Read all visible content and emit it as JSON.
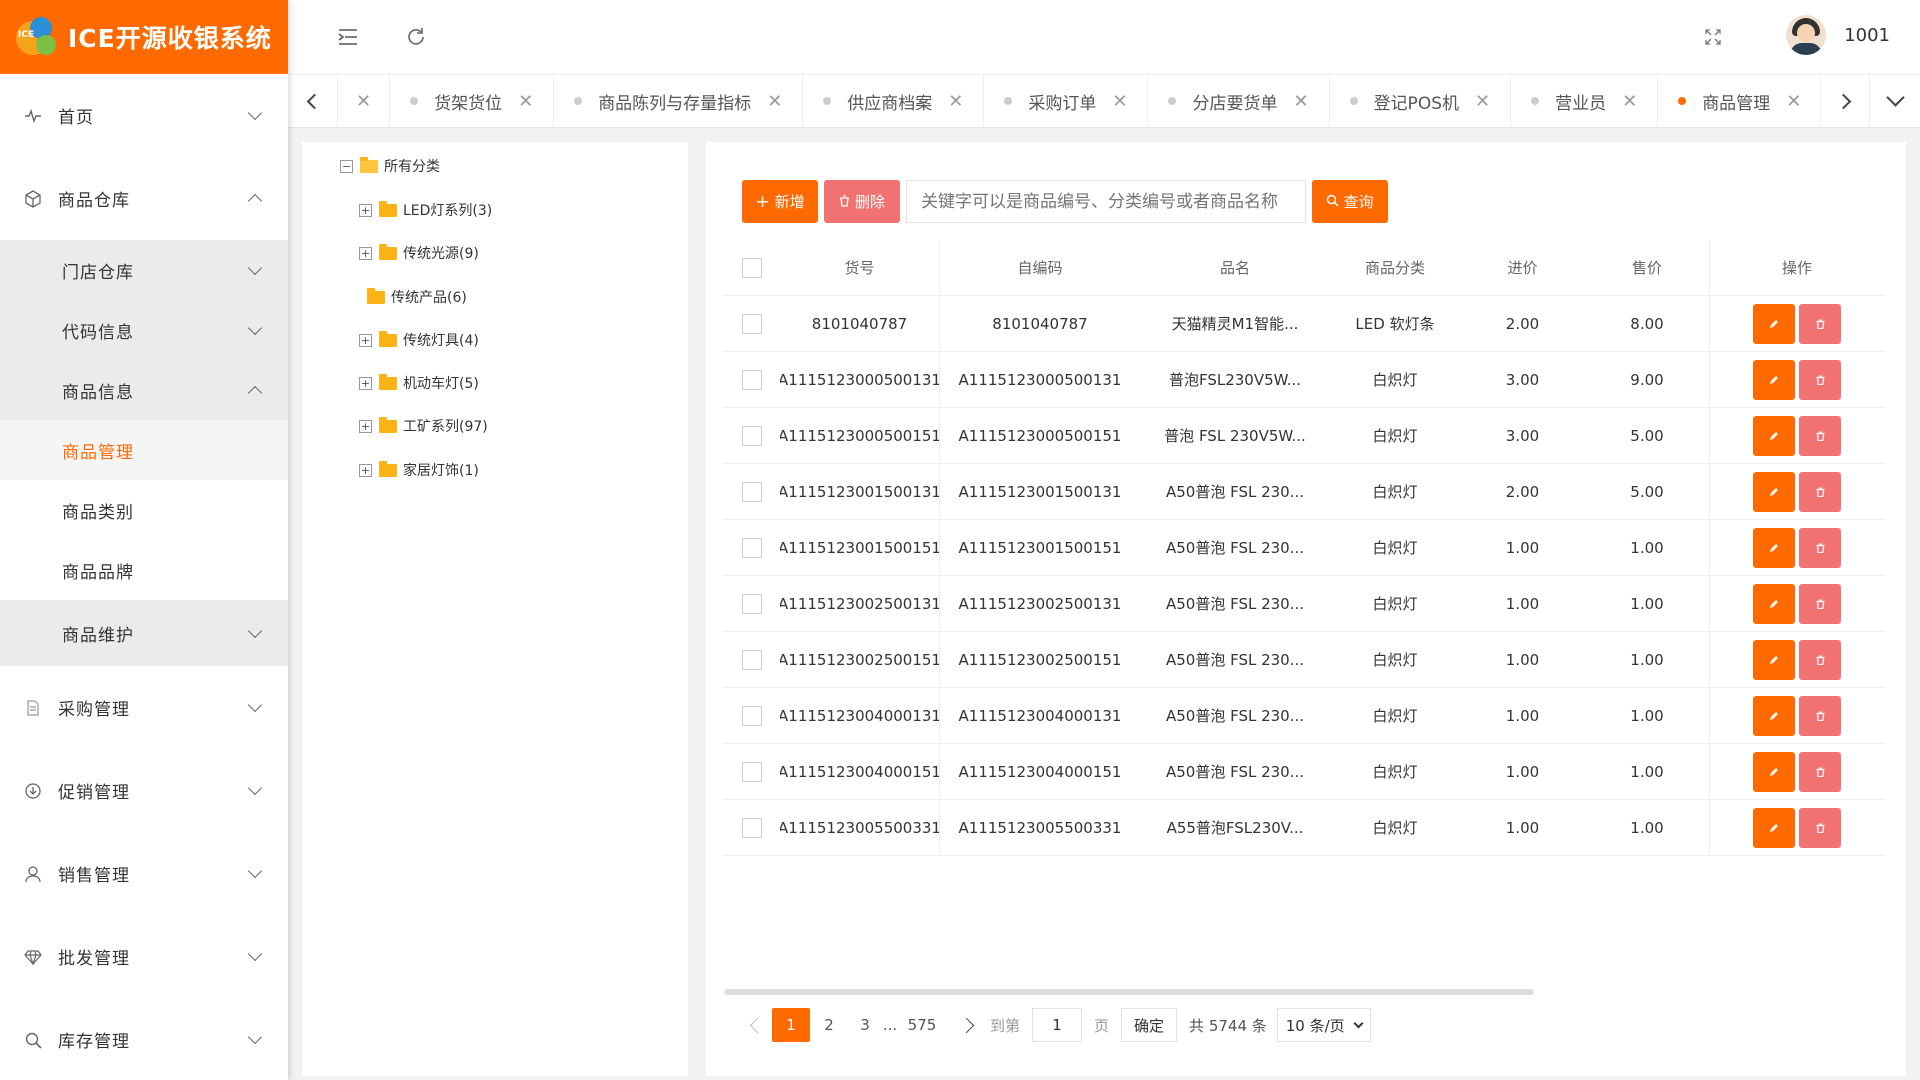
{
  "app": {
    "title": "ICE开源收银系统",
    "logo_text": "ICE"
  },
  "header": {
    "username": "1001"
  },
  "sidebar": {
    "items": [
      {
        "label": "首页",
        "icon": "activity-icon"
      },
      {
        "label": "商品仓库",
        "icon": "box-icon"
      },
      {
        "label": "采购管理",
        "icon": "document-icon"
      },
      {
        "label": "促销管理",
        "icon": "download-circle-icon"
      },
      {
        "label": "销售管理",
        "icon": "user-icon"
      },
      {
        "label": "批发管理",
        "icon": "diamond-icon"
      },
      {
        "label": "库存管理",
        "icon": "search-icon"
      }
    ],
    "sub": {
      "store_warehouse": "门店仓库",
      "code_info": "代码信息",
      "product_info": "商品信息",
      "product_mgmt": "商品管理",
      "product_category": "商品类别",
      "product_brand": "商品品牌",
      "product_maintenance": "商品维护"
    }
  },
  "tabs": [
    {
      "label": "货架货位"
    },
    {
      "label": "商品陈列与存量指标"
    },
    {
      "label": "供应商档案"
    },
    {
      "label": "采购订单"
    },
    {
      "label": "分店要货单"
    },
    {
      "label": "登记POS机"
    },
    {
      "label": "营业员"
    },
    {
      "label": "商品管理",
      "active": true
    }
  ],
  "tree": {
    "root": "所有分类",
    "children": [
      {
        "label": "LED灯系列(3)",
        "expandable": true
      },
      {
        "label": "传统光源(9)",
        "expandable": true
      },
      {
        "label": "传统产品(6)",
        "expandable": false
      },
      {
        "label": "传统灯具(4)",
        "expandable": true
      },
      {
        "label": "机动车灯(5)",
        "expandable": true
      },
      {
        "label": "工矿系列(97)",
        "expandable": true
      },
      {
        "label": "家居灯饰(1)",
        "expandable": true
      }
    ]
  },
  "toolbar": {
    "add_label": "新增",
    "delete_label": "删除",
    "search_placeholder": "关键字可以是商品编号、分类编号或者商品名称",
    "query_label": "查询"
  },
  "table": {
    "headers": {
      "no": "货号",
      "code": "自编码",
      "name": "品名",
      "category": "商品分类",
      "in_price": "进价",
      "out_price": "售价",
      "ops": "操作"
    },
    "rows": [
      {
        "no": "8101040787",
        "code": "8101040787",
        "name": "天猫精灵M1智能...",
        "category": "LED 软灯条",
        "in_price": "2.00",
        "out_price": "8.00"
      },
      {
        "no": "A1115123000500131",
        "code": "A1115123000500131",
        "name": "普泡FSL230V5W...",
        "category": "白炽灯",
        "in_price": "3.00",
        "out_price": "9.00"
      },
      {
        "no": "A1115123000500151",
        "code": "A1115123000500151",
        "name": "普泡 FSL 230V5W...",
        "category": "白炽灯",
        "in_price": "3.00",
        "out_price": "5.00"
      },
      {
        "no": "A1115123001500131",
        "code": "A1115123001500131",
        "name": "A50普泡 FSL 230...",
        "category": "白炽灯",
        "in_price": "2.00",
        "out_price": "5.00"
      },
      {
        "no": "A1115123001500151",
        "code": "A1115123001500151",
        "name": "A50普泡 FSL 230...",
        "category": "白炽灯",
        "in_price": "1.00",
        "out_price": "1.00"
      },
      {
        "no": "A1115123002500131",
        "code": "A1115123002500131",
        "name": "A50普泡 FSL 230...",
        "category": "白炽灯",
        "in_price": "1.00",
        "out_price": "1.00"
      },
      {
        "no": "A1115123002500151",
        "code": "A1115123002500151",
        "name": "A50普泡 FSL 230...",
        "category": "白炽灯",
        "in_price": "1.00",
        "out_price": "1.00"
      },
      {
        "no": "A1115123004000131",
        "code": "A1115123004000131",
        "name": "A50普泡 FSL 230...",
        "category": "白炽灯",
        "in_price": "1.00",
        "out_price": "1.00"
      },
      {
        "no": "A1115123004000151",
        "code": "A1115123004000151",
        "name": "A50普泡 FSL 230...",
        "category": "白炽灯",
        "in_price": "1.00",
        "out_price": "1.00"
      },
      {
        "no": "A1115123005500331",
        "code": "A1115123005500331",
        "name": "A55普泡FSL230V...",
        "category": "白炽灯",
        "in_price": "1.00",
        "out_price": "1.00"
      }
    ]
  },
  "pager": {
    "pages": [
      "1",
      "2",
      "3",
      "...",
      "575"
    ],
    "goto_label": "到第",
    "goto_value": "1",
    "page_unit": "页",
    "confirm_label": "确定",
    "total_label": "共 5744 条",
    "page_size": "10 条/页"
  },
  "colors": {
    "accent": "#ff6a00",
    "danger": "#f27272"
  }
}
